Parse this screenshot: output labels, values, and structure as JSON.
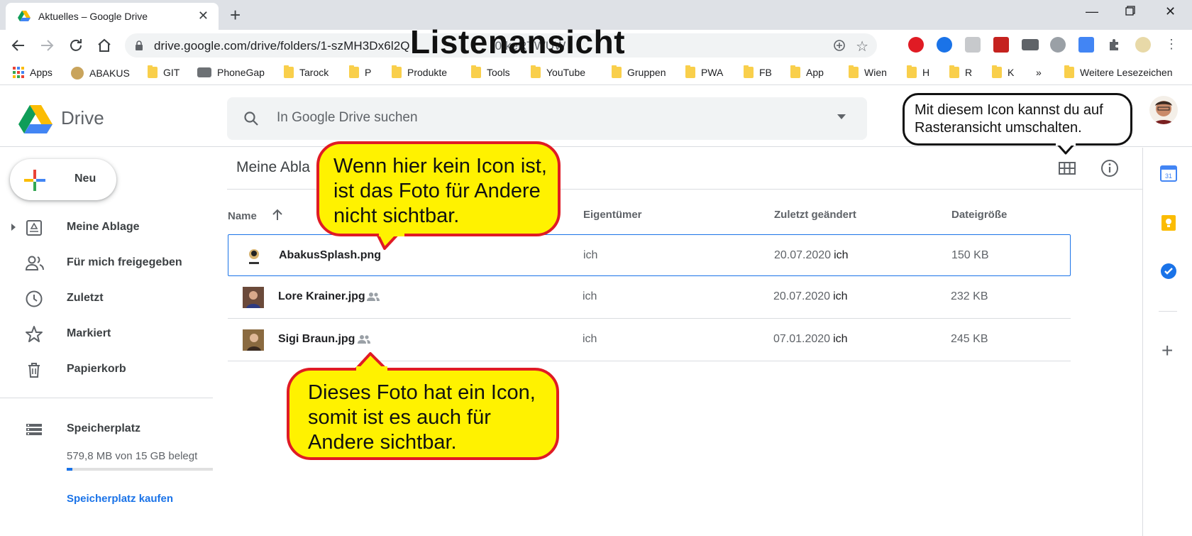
{
  "browser": {
    "tab_title": "Aktuelles – Google Drive",
    "url_main": "drive.google.com/drive/folders/1-szMH3Dx6l2Q",
    "url_tail": "0fkeRTWUW",
    "bookmarks": [
      "Apps",
      "ABAKUS",
      "GIT",
      "PhoneGap",
      "Tarock",
      "P",
      "Produkte",
      "Tools",
      "YouTube",
      "Gruppen",
      "PWA",
      "FB",
      "App",
      "Wien",
      "H",
      "R",
      "K"
    ],
    "bookmarks_more": "»",
    "bookmarks_other": "Weitere Lesezeichen"
  },
  "drive": {
    "app_name": "Drive",
    "search_placeholder": "In Google Drive suchen",
    "new_button": "Neu",
    "nav": [
      {
        "label": "Meine Ablage",
        "icon": "my-drive-icon"
      },
      {
        "label": "Für mich freigegeben",
        "icon": "shared-people-icon"
      },
      {
        "label": "Zuletzt",
        "icon": "clock-icon"
      },
      {
        "label": "Markiert",
        "icon": "star-icon"
      },
      {
        "label": "Papierkorb",
        "icon": "trash-icon"
      }
    ],
    "storage": {
      "label": "Speicherplatz",
      "usage_text": "579,8 MB von 15 GB belegt",
      "used_fraction": 0.038,
      "buy_link": "Speicherplatz kaufen"
    },
    "breadcrumb": "Meine Abla",
    "columns": {
      "name": "Name",
      "owner": "Eigentümer",
      "modified": "Zuletzt geändert",
      "size": "Dateigröße"
    },
    "files": [
      {
        "name": "AbakusSplash.png",
        "shared": false,
        "owner": "ich",
        "date": "20.07.2020",
        "modified_by": "ich",
        "size": "150 KB",
        "selected": true
      },
      {
        "name": "Lore Krainer.jpg",
        "shared": true,
        "owner": "ich",
        "date": "20.07.2020",
        "modified_by": "ich",
        "size": "232 KB",
        "selected": false
      },
      {
        "name": "Sigi Braun.jpg",
        "shared": true,
        "owner": "ich",
        "date": "07.01.2020",
        "modified_by": "ich",
        "size": "245 KB",
        "selected": false
      }
    ]
  },
  "annotations": {
    "title": "Listenansicht",
    "callout_top_lines": [
      "Wenn hier kein Icon ist,",
      "ist das Foto für Andere",
      "nicht sichtbar."
    ],
    "callout_bottom_lines": [
      "Dieses Foto hat ein Icon,",
      "somit ist es auch für",
      "Andere sichtbar."
    ],
    "callout_grid_lines": [
      "Mit diesem Icon kannst du auf",
      "Rasteransicht umschalten."
    ]
  },
  "colors": {
    "accent": "#1a73e8",
    "callout_fill": "#fff200",
    "callout_border": "#e01b24"
  }
}
